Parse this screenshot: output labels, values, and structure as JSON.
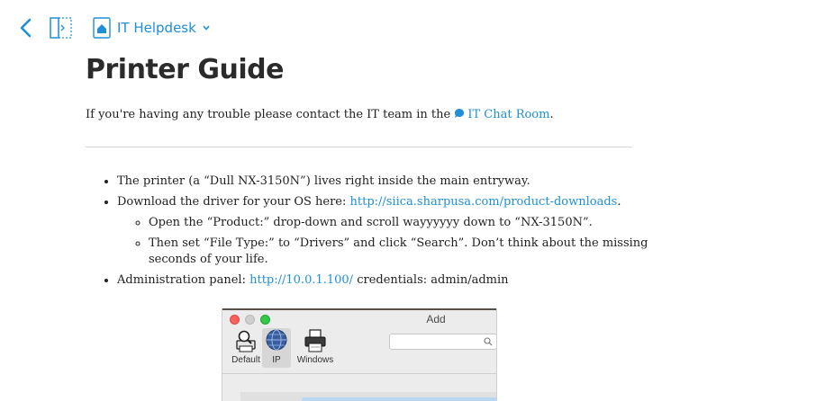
{
  "header": {
    "space_name": "IT Helpdesk",
    "back_icon": "chevron-left-icon",
    "panel_icon": "sidebar-toggle-icon",
    "space_icon": "home-icon",
    "accent_color": "#1f8fd6"
  },
  "page": {
    "title": "Printer Guide",
    "intro_prefix": "If you're having any trouble please contact the IT team in the ",
    "intro_link": "IT Chat Room",
    "intro_suffix": "."
  },
  "steps": {
    "printer_location": "The printer (a “Dull NX-3150N”) lives right inside the main entryway.",
    "download_prefix": "Download the driver for your OS here: ",
    "download_link": "http://siica.sharpusa.com/product-downloads",
    "download_suffix": ".",
    "sub_product": "Open the “Product:” drop-down and scroll wayyyyyy down to “NX-3150N”.",
    "sub_filetype": "Then set “File Type:” to “Drivers” and click “Search”. Don’t think about the missing seconds of your life.",
    "admin_prefix": "Administration panel: ",
    "admin_link": "http://10.0.1.100/",
    "admin_suffix": " credentials: admin/admin"
  },
  "screenshot": {
    "window_title": "Add",
    "toolbar": [
      "Default",
      "IP",
      "Windows"
    ],
    "selected_tool": "IP"
  }
}
